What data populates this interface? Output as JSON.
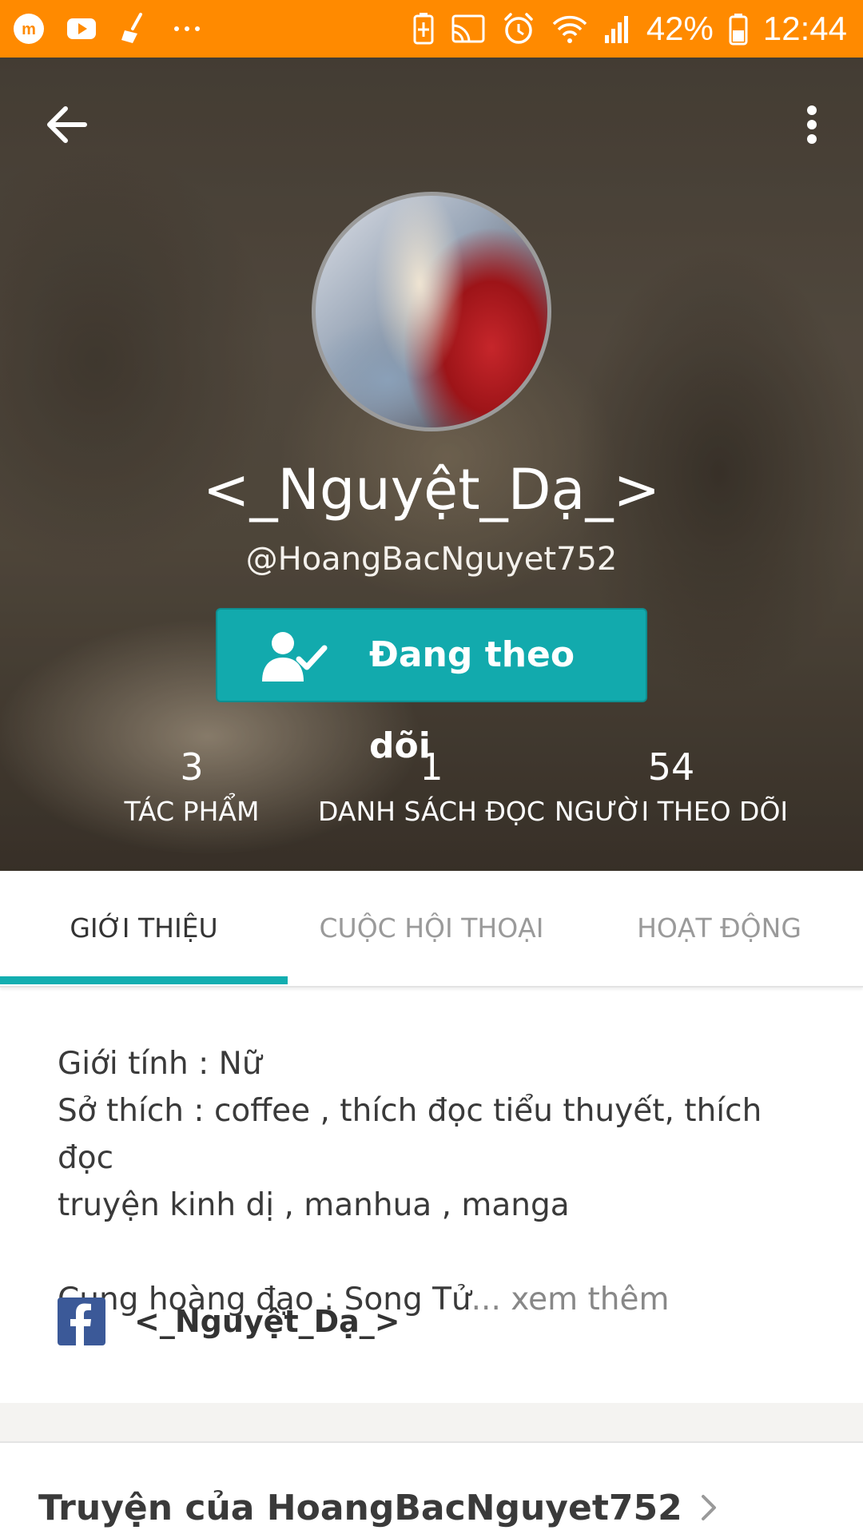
{
  "status_bar": {
    "battery_percent": "42%",
    "time": "12:44",
    "color": "#ff8a00"
  },
  "profile": {
    "display_name": "<_Nguyệt_Dạ_>",
    "username": "@HoangBacNguyet752",
    "follow_button_label": "Đang theo dõi",
    "accent_color": "#12aaad"
  },
  "stats": [
    {
      "value": "3",
      "label": "TÁC PHẨM"
    },
    {
      "value": "1",
      "label": "DANH SÁCH ĐỌC"
    },
    {
      "value": "54",
      "label": "NGƯỜI THEO DÕI"
    }
  ],
  "tabs": [
    {
      "label": "GIỚI THIỆU",
      "active": true
    },
    {
      "label": "CUỘC HỘI THOẠI",
      "active": false
    },
    {
      "label": "HOẠT ĐỘNG",
      "active": false
    }
  ],
  "about": {
    "line1": "Giới tính : Nữ",
    "line2": "Sở thích : coffee , thích đọc tiểu thuyết, thích đọc",
    "line3": "truyện kinh dị , manhua , manga",
    "line4": "Cung hoàng đạo : Song Tử",
    "see_more": "... xem thêm",
    "facebook_name": "<_Nguyệt_Dạ_>"
  },
  "stories_section": {
    "title": "Truyện của HoangBacNguyet752"
  },
  "icons": {
    "back": "arrow-left-icon",
    "more": "more-vertical-icon",
    "follow": "user-check-icon",
    "facebook": "facebook-icon",
    "chevron": "chevron-right-icon"
  }
}
